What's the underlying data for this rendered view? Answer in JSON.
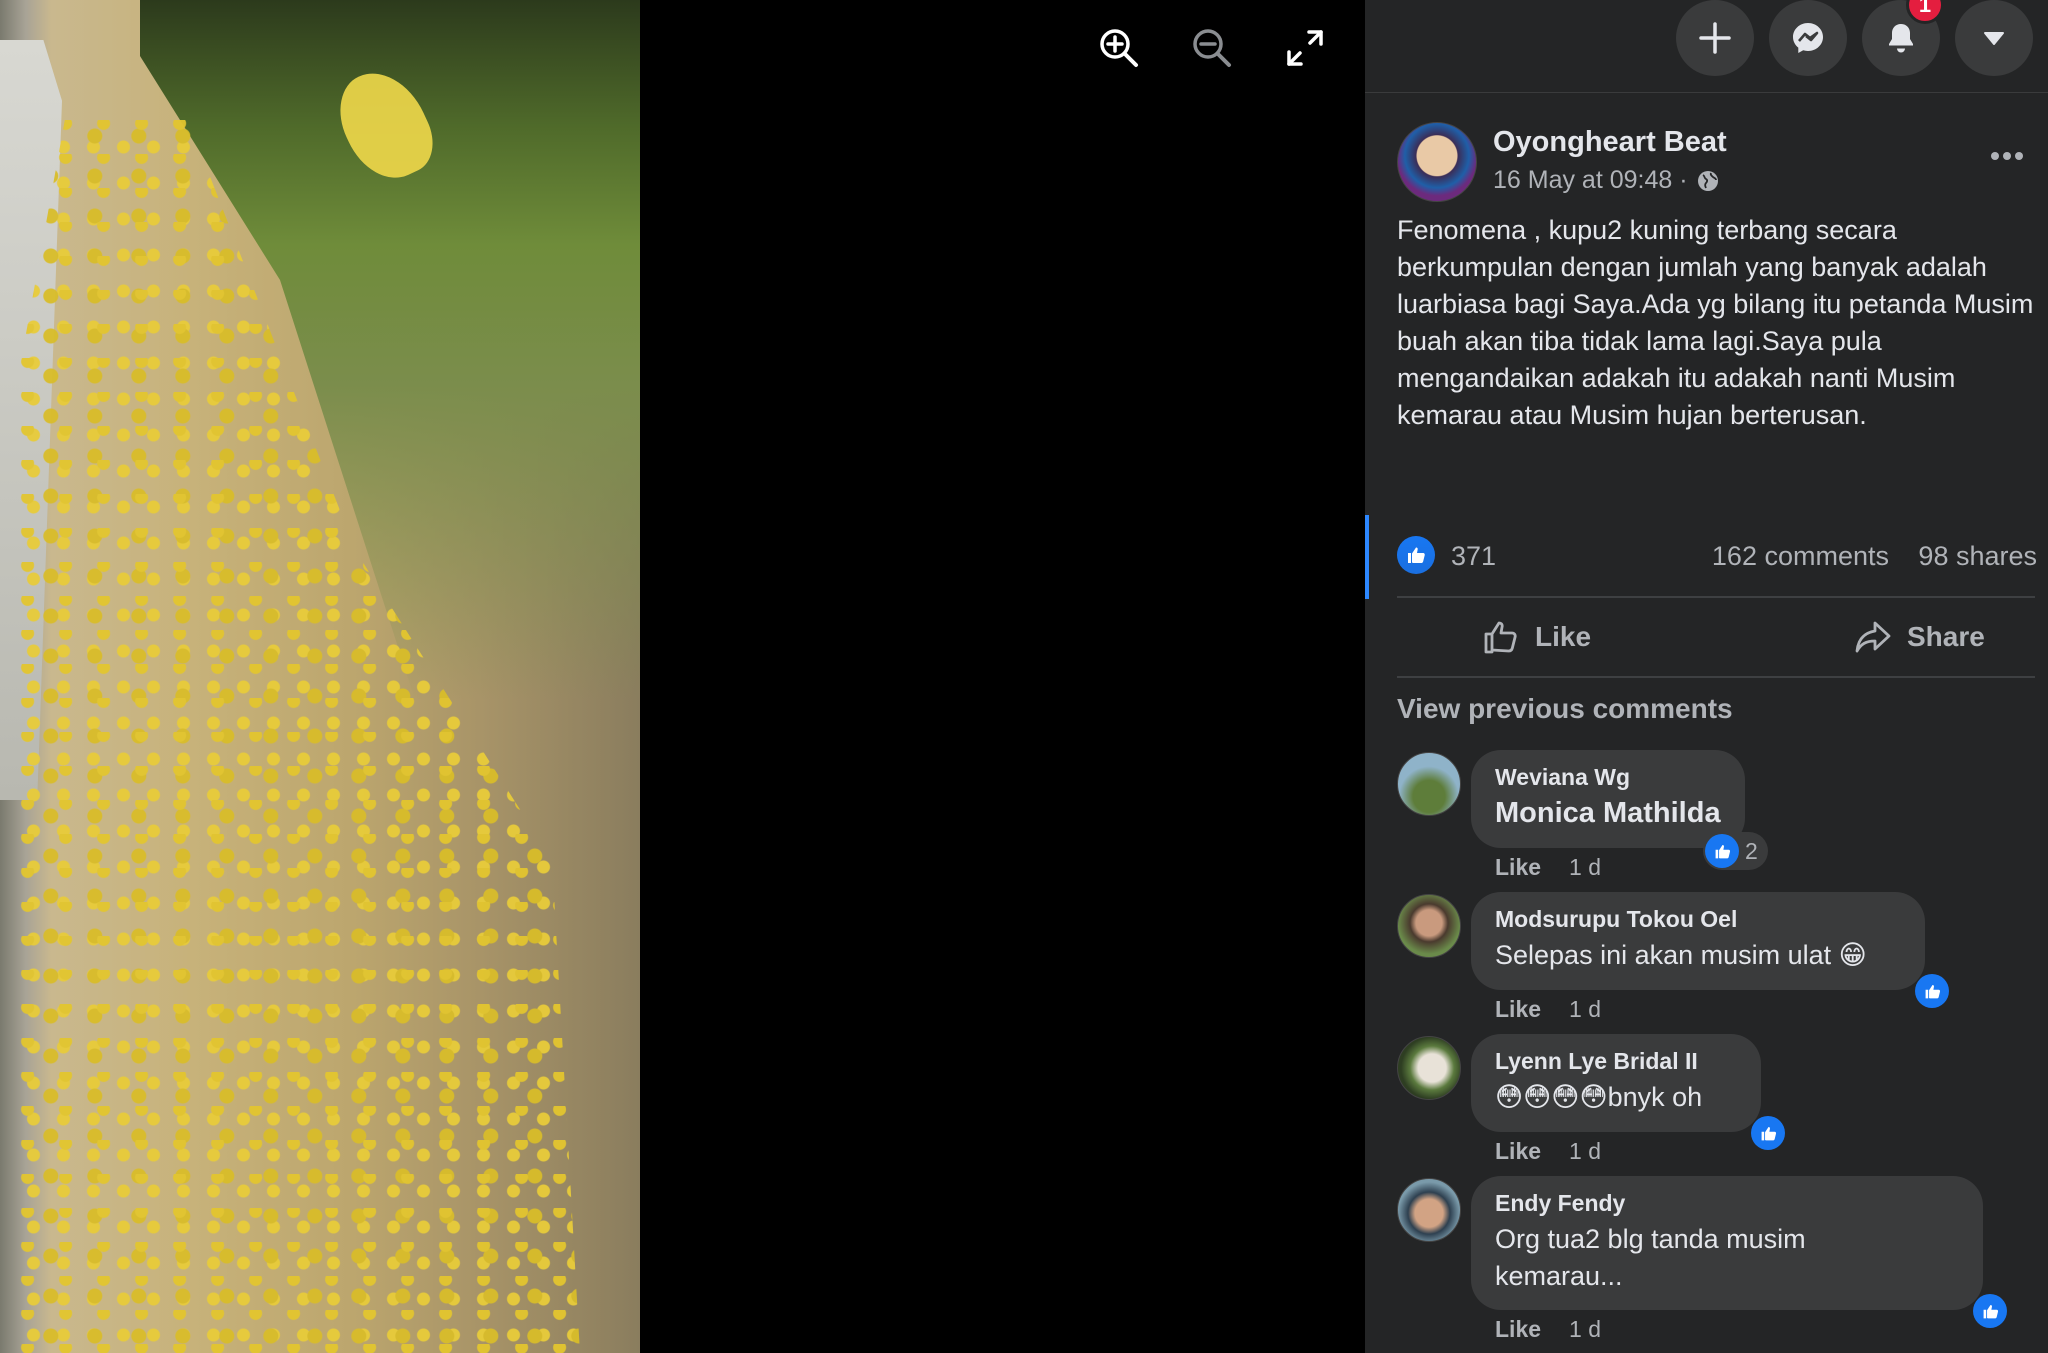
{
  "topbar": {
    "create_icon": "plus-icon",
    "messenger_icon": "messenger-icon",
    "notifications_icon": "bell-icon",
    "notifications_badge": "1",
    "account_icon": "caret-down-icon"
  },
  "viewer": {
    "zoom_in_icon": "zoom-in-icon",
    "zoom_out_icon": "zoom-out-icon",
    "fullscreen_icon": "fullscreen-icon"
  },
  "post": {
    "author": "Oyongheart Beat",
    "date": "16 May at 09:48 ·",
    "privacy_icon": "globe-icon",
    "text": "Fenomena , kupu2 kuning terbang secara berkumpulan dengan jumlah yang banyak adalah luarbiasa bagi Saya.Ada yg bilang itu petanda Musim buah akan tiba tidak lama lagi.Saya pula mengandaikan adakah itu adakah nanti Musim kemarau atau Musim hujan berterusan.",
    "reactions_count": "371",
    "comments_count": "162 comments",
    "shares_count": "98 shares",
    "like_label": "Like",
    "share_label": "Share",
    "view_previous": "View previous comments"
  },
  "comments": [
    {
      "name": "Weviana Wg",
      "text": "Monica Mathilda",
      "reactions": "2",
      "like": "Like",
      "time": "1 d"
    },
    {
      "name": "Modsurupu Tokou Oel",
      "text": "Selepas ini akan musim ulat 😁",
      "reactions": "",
      "like": "Like",
      "time": "1 d"
    },
    {
      "name": "Lyenn Lye Bridal II",
      "text": "😳😳😳😳bnyk oh",
      "reactions": "",
      "like": "Like",
      "time": "1 d"
    },
    {
      "name": "Endy Fendy",
      "text": "Org tua2 blg tanda musim kemarau...",
      "reactions": "",
      "like": "Like",
      "time": "1 d"
    }
  ],
  "colors": {
    "panel_bg": "#242526",
    "bubble_bg": "#3a3b3c",
    "accent": "#1877f2",
    "badge": "#e41e3f",
    "text_primary": "#e4e6eb",
    "text_secondary": "#b0b3b8"
  }
}
